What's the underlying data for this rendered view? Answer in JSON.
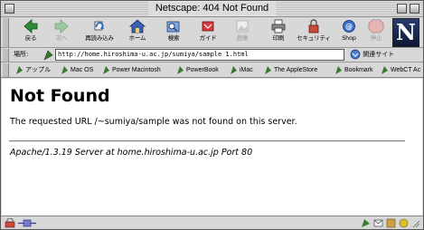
{
  "window": {
    "title": "Netscape: 404 Not Found"
  },
  "toolbar": {
    "buttons": [
      {
        "label": "戻る",
        "icon": "back-arrow-icon",
        "enabled": true
      },
      {
        "label": "次へ",
        "icon": "forward-arrow-icon",
        "enabled": false
      },
      {
        "label": "再読み込み",
        "icon": "reload-icon",
        "enabled": true
      },
      {
        "label": "ホーム",
        "icon": "home-icon",
        "enabled": true
      },
      {
        "label": "検索",
        "icon": "search-icon",
        "enabled": true
      },
      {
        "label": "ガイド",
        "icon": "guide-icon",
        "enabled": true
      },
      {
        "label": "画像",
        "icon": "images-icon",
        "enabled": false
      },
      {
        "label": "印刷",
        "icon": "print-icon",
        "enabled": true
      },
      {
        "label": "セキュリティ",
        "icon": "security-lock-icon",
        "enabled": true
      },
      {
        "label": "Shop",
        "icon": "shop-icon",
        "enabled": true
      },
      {
        "label": "停止",
        "icon": "stop-icon",
        "enabled": false
      }
    ],
    "logo": "N"
  },
  "location": {
    "label": "場所:",
    "url": "http://home.hiroshima-u.ac.jp/sumiya/sample 1.html",
    "related_label": "関連サイト"
  },
  "personal_toolbar": {
    "items": [
      "アップル",
      "Mac OS",
      "Power Macintosh",
      "PowerBook",
      "iMac",
      "The AppleStore",
      "Bookmark",
      "WebCT Ac"
    ]
  },
  "page": {
    "heading": "Not Found",
    "message": "The requested URL /~sumiya/sample was not found on this server.",
    "footer": "Apache/1.3.19 Server at home.hiroshima-u.ac.jp Port 80"
  },
  "colors": {
    "chrome": "#dcdcdc",
    "logo_bg": "#1a2850",
    "link_icon": "#3a7a2e"
  }
}
